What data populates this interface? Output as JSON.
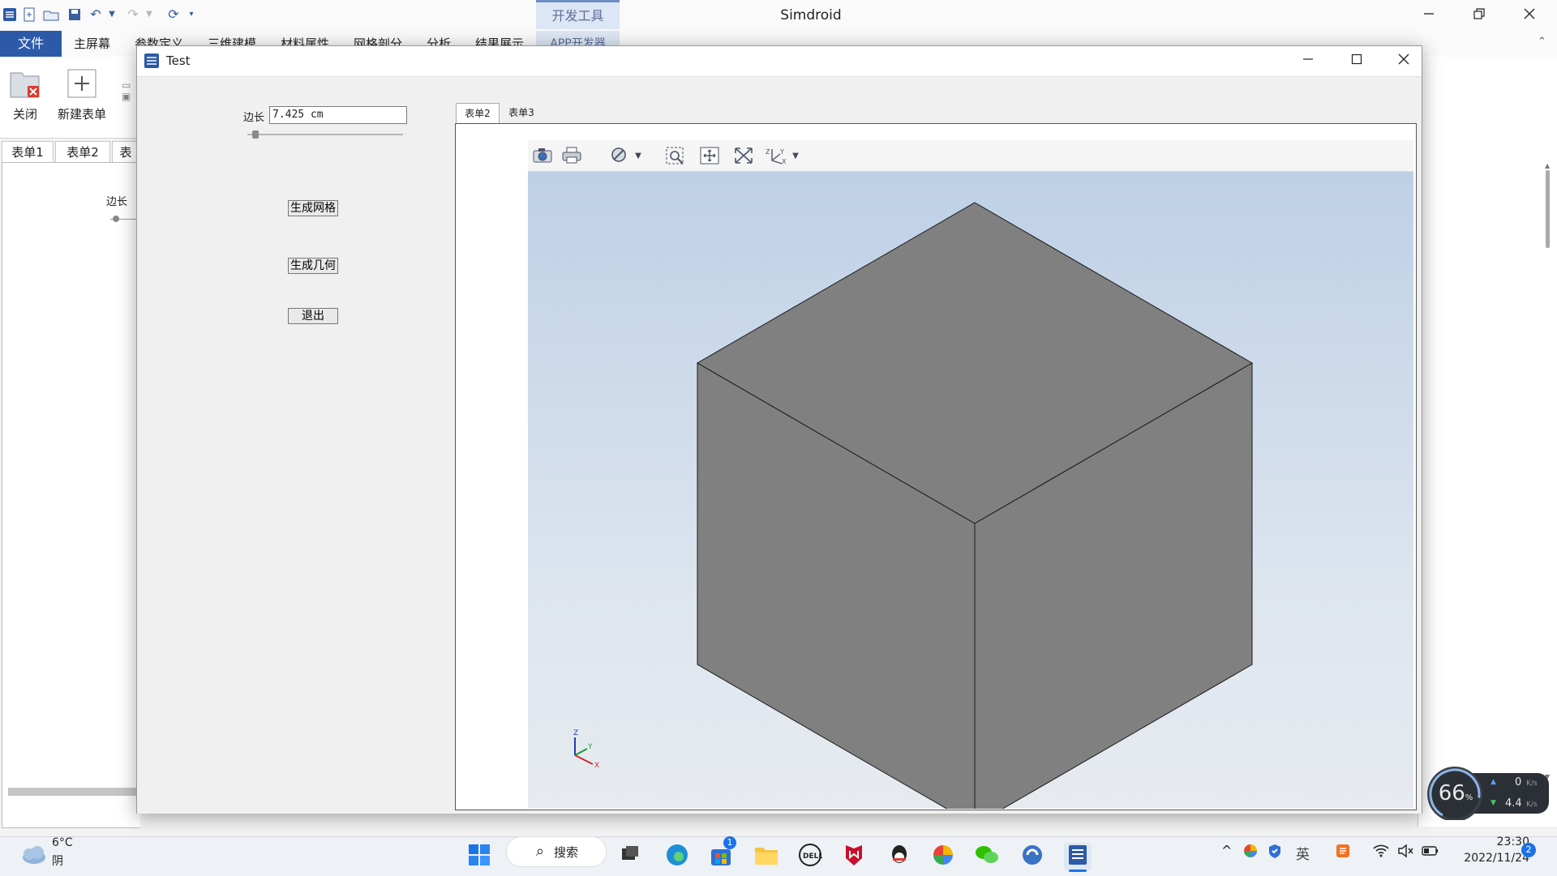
{
  "app": {
    "title": "Simdroid",
    "contextual_tab": "开发工具",
    "window_controls": [
      "minimize-icon",
      "restore-icon",
      "close-icon"
    ]
  },
  "ribbon": {
    "file_tab": "文件",
    "tabs": [
      "主屏幕",
      "参数定义",
      "三维建模",
      "材料属性",
      "网格剖分",
      "分析",
      "结果展示"
    ],
    "active_tab": "APP开发器",
    "buttons": [
      {
        "label": "关闭",
        "icon": "close-folder-icon"
      },
      {
        "label": "新建表单",
        "icon": "new-form-icon"
      }
    ]
  },
  "background_forms": {
    "tabs": [
      "表单1",
      "表单2",
      "表"
    ],
    "edge_label": "边长"
  },
  "dialog": {
    "title": "Test",
    "edge_label": "边长",
    "edge_value": "7.425 cm",
    "slider_fraction": 0.05,
    "buttons": {
      "mesh": "生成网格",
      "geometry": "生成几何",
      "exit": "退出"
    },
    "viewer_tabs": [
      "表单2",
      "表单3"
    ],
    "active_viewer_tab": "表单2",
    "toolbar_icons": [
      "camera-icon",
      "print-icon",
      "hide-icon",
      "zoom-box-icon",
      "pan-icon",
      "fit-view-icon",
      "axis-orient-icon"
    ],
    "axis_labels": {
      "z": "Z",
      "y": "Y",
      "x": "X"
    },
    "colors": {
      "cube_fill": "#808080",
      "viewport_top": "#bed0e6",
      "viewport_bottom": "#e7ebf0"
    }
  },
  "taskbar": {
    "weather_temp": "6°C",
    "weather_desc": "阴",
    "search_label": "搜索",
    "store_badge": "1",
    "time": "23:30",
    "date": "2022/11/24",
    "notification_count": "2",
    "gauge": {
      "percent": "66",
      "percent_unit": "%",
      "up_speed": "0",
      "down_speed": "4.4",
      "unit": "K/s"
    }
  }
}
